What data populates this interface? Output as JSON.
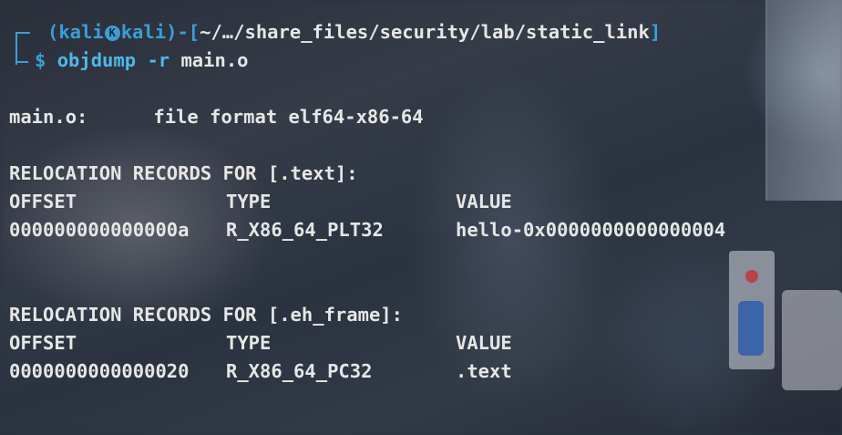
{
  "prompt": {
    "open_paren": "(",
    "user": "kali",
    "separator_icon": "kali-dragon-icon",
    "host": "kali",
    "close_paren": ")",
    "dash": "-",
    "open_bracket": "[",
    "path": "~/…/share_files/security/lab/static_link",
    "close_bracket": "]",
    "dollar": "$",
    "command": "objdump",
    "flag": "-r",
    "arg": "main.o"
  },
  "output": {
    "file_line_name": "main.o:",
    "file_line_format": "file format elf64-x86-64",
    "sections": [
      {
        "title": "RELOCATION RECORDS FOR [.text]:",
        "headers": {
          "offset": "OFFSET",
          "type": "TYPE",
          "value": "VALUE"
        },
        "rows": [
          {
            "offset": "000000000000000a",
            "type": "R_X86_64_PLT32",
            "value": "hello-0x0000000000000004"
          }
        ]
      },
      {
        "title": "RELOCATION RECORDS FOR [.eh_frame]:",
        "headers": {
          "offset": "OFFSET",
          "type": "TYPE",
          "value": "VALUE"
        },
        "rows": [
          {
            "offset": "0000000000000020",
            "type": "R_X86_64_PC32",
            "value": ".text"
          }
        ]
      }
    ]
  },
  "colors": {
    "prompt_accent": "#3a9fd6",
    "command": "#4fb7e8",
    "text": "#e6e6e6",
    "background": "#2b3340"
  }
}
